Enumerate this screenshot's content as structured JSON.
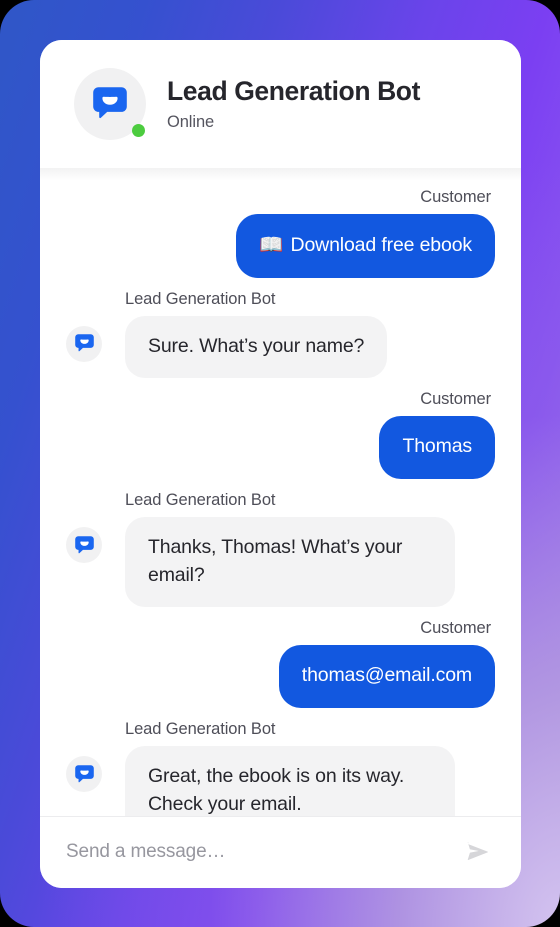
{
  "widget": {
    "header": {
      "avatar_icon": "chatbot-logo-icon",
      "title": "Lead Generation Bot",
      "status": "Online",
      "status_dot_color": "#4ccc3f"
    },
    "messages": [
      {
        "sender": "customer",
        "speaker_label": "Customer",
        "emoji": "📖",
        "text": "Download free ebook"
      },
      {
        "sender": "bot",
        "speaker_label": "Lead Generation Bot",
        "avatar_icon": "chatbot-logo-icon",
        "text": "Sure. What’s your name?"
      },
      {
        "sender": "customer",
        "speaker_label": "Customer",
        "text": "Thomas"
      },
      {
        "sender": "bot",
        "speaker_label": "Lead Generation Bot",
        "avatar_icon": "chatbot-logo-icon",
        "text": "Thanks, Thomas! What’s your email?"
      },
      {
        "sender": "customer",
        "speaker_label": "Customer",
        "text": "thomas@email.com"
      },
      {
        "sender": "bot",
        "speaker_label": "Lead Generation Bot",
        "avatar_icon": "chatbot-logo-icon",
        "text": "Great, the ebook is on its way. Check your email."
      }
    ],
    "composer": {
      "placeholder": "Send a message…",
      "value": "",
      "send_icon": "send-paper-plane-icon"
    },
    "colors": {
      "customer_bubble": "#1258e0",
      "bot_bubble": "#f3f3f4",
      "brand_blue": "#1a66f0",
      "gradient_start": "#2f57c7",
      "gradient_mid": "#7b3ff2",
      "gradient_end": "#b99fe2"
    }
  }
}
